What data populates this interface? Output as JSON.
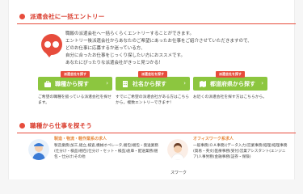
{
  "section1": {
    "title": "派遣会社に一括エントリー"
  },
  "intro": {
    "lines": [
      "職飯の派遣会社へ一括らくらくエントリーすることができます。",
      "エントリー後派遣会社からあなたのご希望にあったお仕事をご紹介させていただきますので、",
      "どのお仕事に応募するか迷っている方、",
      "自分に合ったお仕事をじっくり探したい方におススメです。",
      "あなたにぴったりな派遣会社がきっと見つかる！"
    ]
  },
  "buttons": [
    {
      "badge": "派遣会社を探す",
      "label": "職種から探す",
      "icon": "briefcase-icon",
      "desc": "ご希望の職種を扱っている派遣会社を探せます。"
    },
    {
      "badge": "派遣会社を探す",
      "label": "社名から探す",
      "icon": "building-icon",
      "desc": "すでにご希望の派遣会社がある方はこちらから。複数エントリーできます！"
    },
    {
      "badge": "派遣会社を探す",
      "label": "都道府県から探す",
      "icon": "map-icon",
      "desc": "お近くの派遣会社を探す方はこちらから。"
    }
  ],
  "section2": {
    "title": "職種から仕事を探そう"
  },
  "jobs": [
    {
      "title": "製造・物流・軽作業系の求人",
      "list": "製造業務(加工,組立,検査,機械オペレータ,梱包)梱包・発送業務(仕分け・検品)梱包(仕分け・セット・検品)倉庫・配送業務(梱包・仕分け)その他"
    },
    {
      "title": "オフィスワーク系求人",
      "list": "一般事務(ＯＡ事務)(データ入力)営業事務(経理)経理事務(貿易・英文)医療事務(受付)営業アシスタント(エンジニア)人事労務(金融事務(証券・保険)"
    }
  ],
  "footer": {
    "caption": "スワーク"
  },
  "colors": {
    "accent": "#e74c3c",
    "button": "#8cc63f",
    "orange": "#e6873a"
  }
}
